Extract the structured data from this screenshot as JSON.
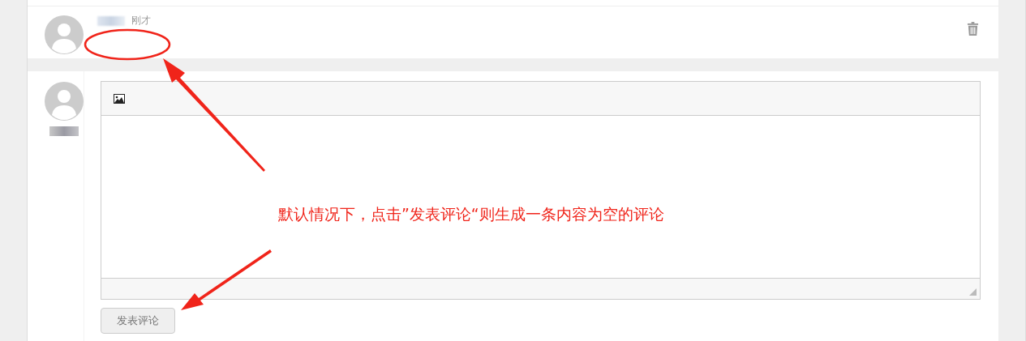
{
  "comment": {
    "time": "刚才"
  },
  "editor": {
    "submit_label": "发表评论"
  },
  "annotation": {
    "text": "默认情况下，点击”发表评论“则生成一条内容为空的评论"
  }
}
